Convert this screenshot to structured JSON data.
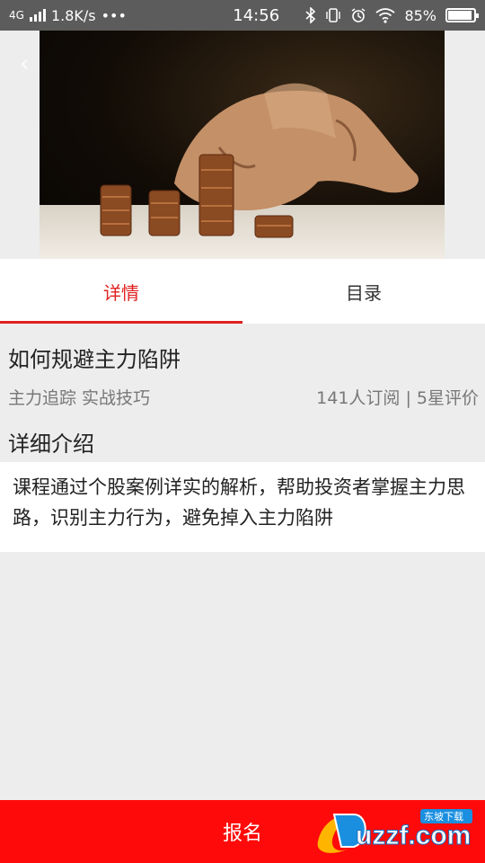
{
  "status_bar": {
    "network": "4G",
    "speed": "1.8K/s",
    "dots": "•••",
    "time": "14:56",
    "battery": "85%"
  },
  "banner": {
    "back_icon": "chevron-left-icon",
    "image_subject": "hand-stacking-coins"
  },
  "tabs": [
    {
      "label": "详情",
      "active": true
    },
    {
      "label": "目录",
      "active": false
    }
  ],
  "course": {
    "title": "如何规避主力陷阱",
    "tags": "主力追踪 实战技巧",
    "stats": "141人订阅 | 5星评价"
  },
  "details": {
    "heading": "详细介绍",
    "description": "课程通过个股案例详实的解析，帮助投资者掌握主力思路，识别主力行为，避免掉入主力陷阱"
  },
  "footer": {
    "signup_label": "报名"
  },
  "watermark": {
    "text": "uzzf.com",
    "badge": "东坡下载"
  },
  "colors": {
    "accent": "#e02020",
    "footer_bg": "#ff0a0a",
    "statusbar_bg": "#5c5c5c"
  }
}
